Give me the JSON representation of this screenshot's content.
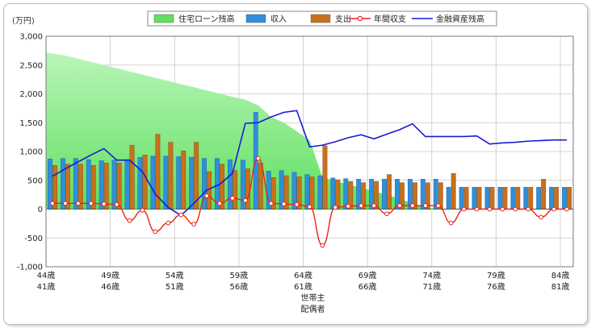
{
  "chart_data": {
    "type": "combo",
    "unit_label": "(万円)",
    "ylim": [
      -1000,
      3000
    ],
    "y_ticks": [
      "-1,000",
      "-500",
      "0",
      "500",
      "1,000",
      "1,500",
      "2,000",
      "2,500",
      "3,000"
    ],
    "x_label_rows": {
      "row1_label": "世帯主",
      "row2_label": "配偶者",
      "row1_ticks": [
        "44歳",
        "49歳",
        "54歳",
        "59歳",
        "64歳",
        "69歳",
        "74歳",
        "79歳",
        "84歳"
      ],
      "row2_ticks": [
        "41歳",
        "46歳",
        "51歳",
        "56歳",
        "61歳",
        "66歳",
        "71歳",
        "76歳",
        "81歳"
      ]
    },
    "legend": [
      "住宅ローン残高",
      "収入",
      "支出",
      "年間収支",
      "金融資産残高"
    ],
    "legend_position": "top",
    "grid": true,
    "colors": {
      "loan": "#5fe05f",
      "income": "#2f8fdc",
      "expense": "#c8701c",
      "annual": "#e8231c",
      "assets": "#1a1ad4"
    },
    "ages": [
      44,
      45,
      46,
      47,
      48,
      49,
      50,
      51,
      52,
      53,
      54,
      55,
      56,
      57,
      58,
      59,
      60,
      61,
      62,
      63,
      64,
      65,
      66,
      67,
      68,
      69,
      70,
      71,
      72,
      73,
      74,
      75,
      76,
      77,
      78,
      79,
      80,
      81,
      82,
      83,
      84
    ],
    "series": [
      {
        "name": "住宅ローン残高",
        "kind": "area",
        "values": [
          2720,
          2665,
          2610,
          2555,
          2500,
          2445,
          2390,
          2335,
          2280,
          2225,
          2170,
          2115,
          2060,
          2005,
          1950,
          1900,
          1800,
          1600,
          1500,
          1350,
          1200,
          550,
          490,
          430,
          370,
          310,
          250,
          180,
          100,
          30,
          0,
          0,
          0,
          0,
          0,
          0,
          0,
          0,
          0,
          0,
          0
        ]
      },
      {
        "name": "収入",
        "kind": "bar",
        "values": [
          870,
          880,
          880,
          860,
          840,
          850,
          860,
          900,
          920,
          920,
          910,
          900,
          880,
          880,
          860,
          850,
          1680,
          660,
          670,
          640,
          600,
          580,
          540,
          530,
          520,
          520,
          520,
          520,
          520,
          520,
          520,
          380,
          380,
          380,
          380,
          380,
          380,
          380,
          380,
          380,
          380
        ]
      },
      {
        "name": "支出",
        "kind": "bar",
        "values": [
          760,
          780,
          780,
          760,
          800,
          800,
          1110,
          940,
          1300,
          1160,
          1010,
          1160,
          650,
          780,
          670,
          700,
          800,
          550,
          580,
          560,
          560,
          1100,
          510,
          480,
          460,
          480,
          600,
          460,
          460,
          460,
          460,
          620,
          380,
          380,
          380,
          380,
          380,
          380,
          520,
          380,
          380
        ]
      },
      {
        "name": "年間収支",
        "kind": "line",
        "values": [
          100,
          100,
          100,
          100,
          90,
          80,
          -200,
          -20,
          -390,
          -240,
          -100,
          -260,
          230,
          100,
          190,
          150,
          880,
          100,
          90,
          80,
          40,
          -630,
          30,
          50,
          60,
          60,
          -80,
          60,
          60,
          60,
          60,
          -240,
          0,
          0,
          0,
          0,
          0,
          0,
          -140,
          0,
          0
        ]
      },
      {
        "name": "金融資産残高",
        "kind": "line",
        "values": [
          570,
          700,
          820,
          940,
          1050,
          850,
          850,
          650,
          260,
          30,
          -110,
          100,
          330,
          430,
          620,
          1490,
          1500,
          1600,
          1680,
          1710,
          1080,
          1110,
          1170,
          1240,
          1290,
          1220,
          1300,
          1380,
          1480,
          1260,
          1260,
          1260,
          1260,
          1270,
          1130,
          1150,
          1160,
          1180,
          1190,
          1200,
          1200
        ]
      }
    ]
  }
}
